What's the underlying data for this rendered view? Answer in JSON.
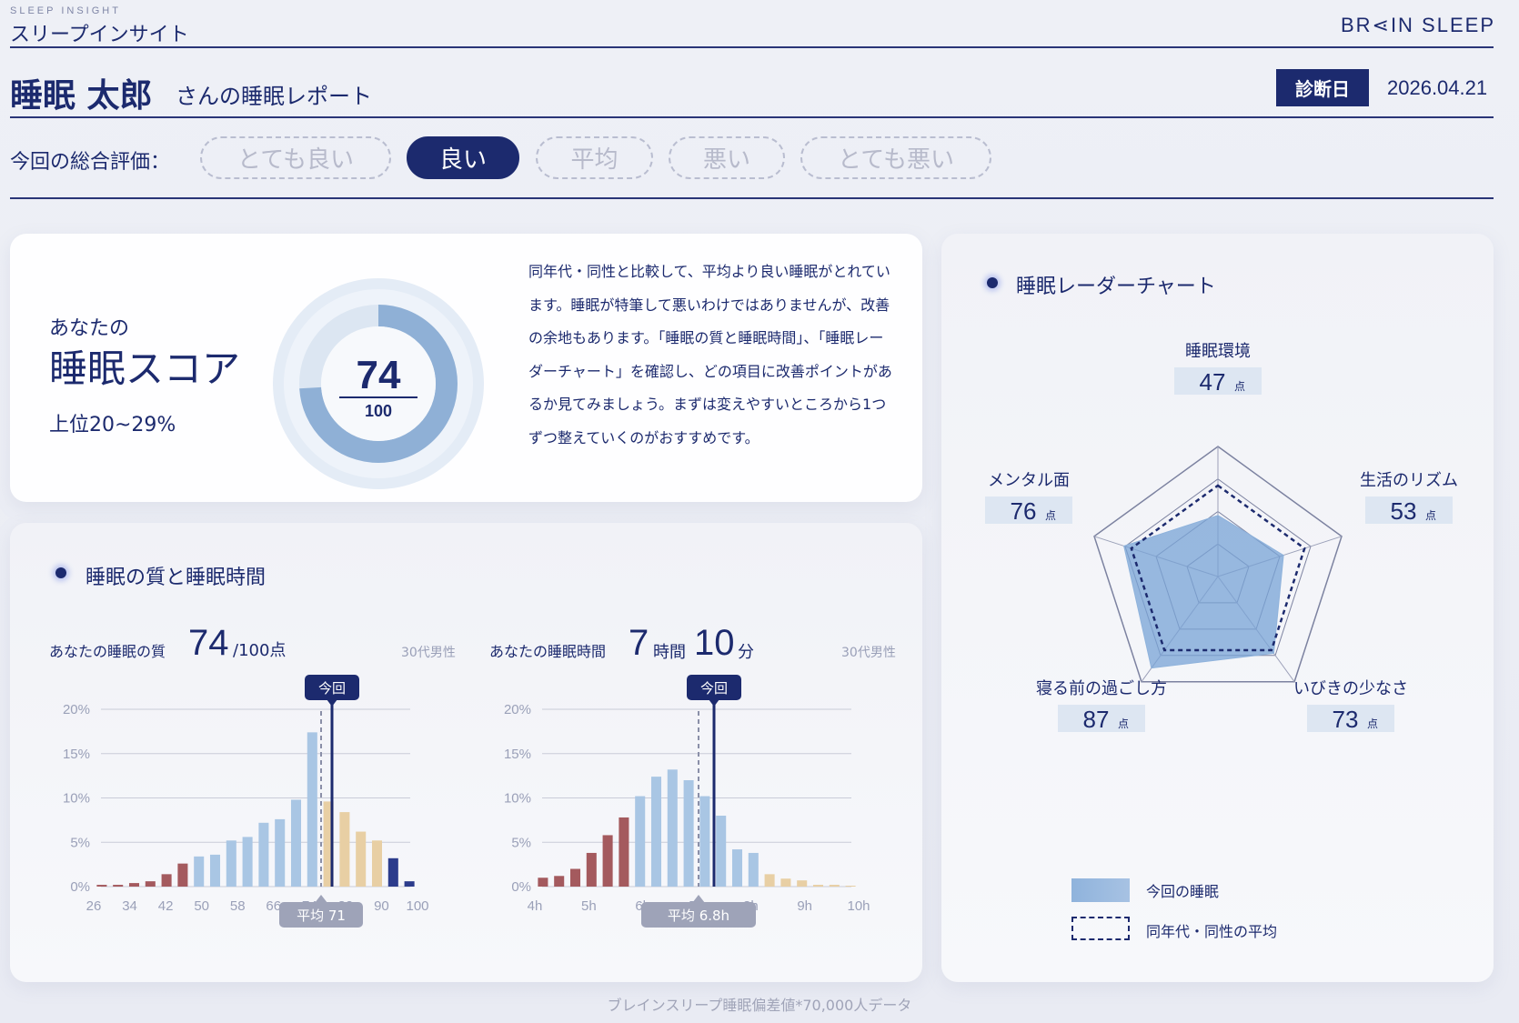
{
  "header": {
    "brand_small": "SLEEP INSIGHT",
    "brand_title": "スリープインサイト",
    "logo": "BR⋖IN SLEEP"
  },
  "report": {
    "name": "睡眠 太郎",
    "suffix": "さんの睡眠レポート",
    "diag_label": "診断日",
    "diag_date": "2026.04.21"
  },
  "evaluation": {
    "label": "今回の総合評価：",
    "options": [
      "とても良い",
      "良い",
      "平均",
      "悪い",
      "とても悪い"
    ],
    "selected": "良い"
  },
  "score": {
    "sub": "あなたの",
    "title": "睡眠スコア",
    "rank": "上位20~29%",
    "value": "74",
    "max": "100",
    "value_fraction": 0.74,
    "description": "同年代・同性と比較して、平均より良い睡眠がとれています。睡眠が特筆して悪いわけではありませんが、改善の余地もあります。「睡眠の質と睡眠時間」、「睡眠レーダーチャート」を確認し、どの項目に改善ポイントがあるか見てみましょう。まずは変えやすいところから1つずつ整えていくのがおすすめです。"
  },
  "hist_section": {
    "title": "睡眠の質と睡眠時間",
    "quality_label": "あなたの睡眠の質",
    "quality_value": "74",
    "quality_unit": "/100点",
    "quality_note": "30代男性",
    "duration_label": "あなたの睡眠時間",
    "duration_hours": "7",
    "duration_hours_unit": "時間",
    "duration_minutes": "10",
    "duration_minutes_unit": "分",
    "duration_note": "30代男性"
  },
  "radar_section": {
    "title": "睡眠レーダーチャート",
    "legend_current": "今回の睡眠",
    "legend_average": "同年代・同性の平均"
  },
  "footer_note": "ブレインスリープ睡眠偏差値*70,000人データ",
  "colors": {
    "navy": "#1c2a6e",
    "blue": "#9fbfdf",
    "red": "#a45a5e",
    "beige": "#e6cfa8",
    "deep_blue": "#2a3a8a"
  },
  "chart_data": [
    {
      "type": "bar",
      "title": "あなたの睡眠の質",
      "x_ticks": [
        "26",
        "34",
        "42",
        "50",
        "58",
        "66",
        "74",
        "82",
        "90",
        "100"
      ],
      "ylim": [
        0,
        20
      ],
      "y_ticks": [
        "0%",
        "5%",
        "10%",
        "15%",
        "20%"
      ],
      "values": [
        0.2,
        0.2,
        0.4,
        0.6,
        1.4,
        2.6,
        3.4,
        3.6,
        5.2,
        5.6,
        7.2,
        7.6,
        9.8,
        17.4,
        9.6,
        8.4,
        6.2,
        5.2,
        3.2,
        0.6
      ],
      "colors": [
        "red",
        "red",
        "red",
        "red",
        "red",
        "red",
        "blue",
        "blue",
        "blue",
        "blue",
        "blue",
        "blue",
        "blue",
        "blue",
        "beige",
        "beige",
        "beige",
        "beige",
        "deep",
        "deep"
      ],
      "current_marker": {
        "label": "今回",
        "value": 74
      },
      "average_marker": {
        "label": "平均 71",
        "value": 71
      }
    },
    {
      "type": "bar",
      "title": "あなたの睡眠時間",
      "x_ticks": [
        "4h",
        "5h",
        "6h",
        "7h",
        "8h",
        "9h",
        "10h"
      ],
      "ylim": [
        0,
        20
      ],
      "y_ticks": [
        "0%",
        "5%",
        "10%",
        "15%",
        "20%"
      ],
      "values": [
        1.0,
        1.2,
        2.0,
        3.8,
        5.8,
        7.8,
        10.2,
        12.4,
        13.2,
        12.0,
        10.2,
        8.0,
        4.2,
        3.8,
        1.4,
        0.9,
        0.7,
        0.2,
        0.2,
        0.1
      ],
      "colors": [
        "red",
        "red",
        "red",
        "red",
        "red",
        "red",
        "blue",
        "blue",
        "blue",
        "blue",
        "blue",
        "blue",
        "blue",
        "blue",
        "beige",
        "beige",
        "beige",
        "beige",
        "beige",
        "beige"
      ],
      "current_marker": {
        "label": "今回",
        "value": "7h10m"
      },
      "average_marker": {
        "label": "平均 6.8h",
        "value": 6.8
      }
    },
    {
      "type": "radar",
      "axes": [
        "睡眠環境",
        "生活のリズム",
        "いびきの少なさ",
        "寝る前の過ごし方",
        "メンタル面"
      ],
      "unit": "点",
      "series": [
        {
          "name": "今回の睡眠",
          "values": [
            47,
            53,
            73,
            87,
            76
          ]
        },
        {
          "name": "同年代・同性の平均",
          "values": [
            70,
            70,
            70,
            70,
            70
          ]
        }
      ],
      "max": 100
    }
  ]
}
